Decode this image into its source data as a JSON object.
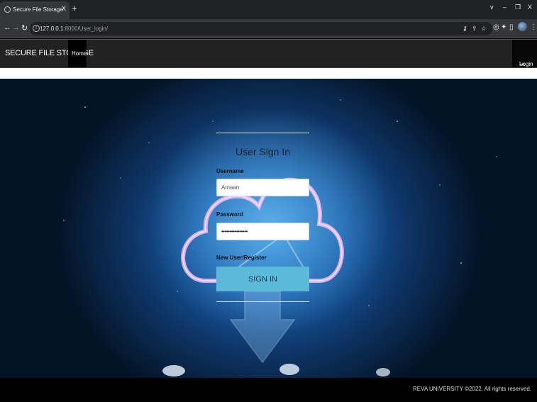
{
  "browser": {
    "tab_title": "Secure File Storage",
    "tab_close": "X",
    "new_tab": "+",
    "url_host": "127.0.0.1",
    "url_path": ":8000/User_login/",
    "window_controls": {
      "chevron": "v",
      "minimize": "–",
      "restore": "❐",
      "close": "X"
    }
  },
  "navbar": {
    "brand": "SECURE FILE STORAGE",
    "home": "Home",
    "login": "Login"
  },
  "form": {
    "title": "User Sign In",
    "username_label": "Username",
    "username_value": "Amaan",
    "password_label": "Password",
    "password_value": "••••••••••••••••",
    "register_link": "New User/Register",
    "submit": "SIGN IN"
  },
  "footer": {
    "copyright": "REVA UNIVERSITY ©2022. All rights reserved."
  },
  "colors": {
    "accent_button": "#5bbad8",
    "navbar_bg": "#222222",
    "hero_center": "#2a7fd0",
    "footer_bg": "#000000"
  }
}
